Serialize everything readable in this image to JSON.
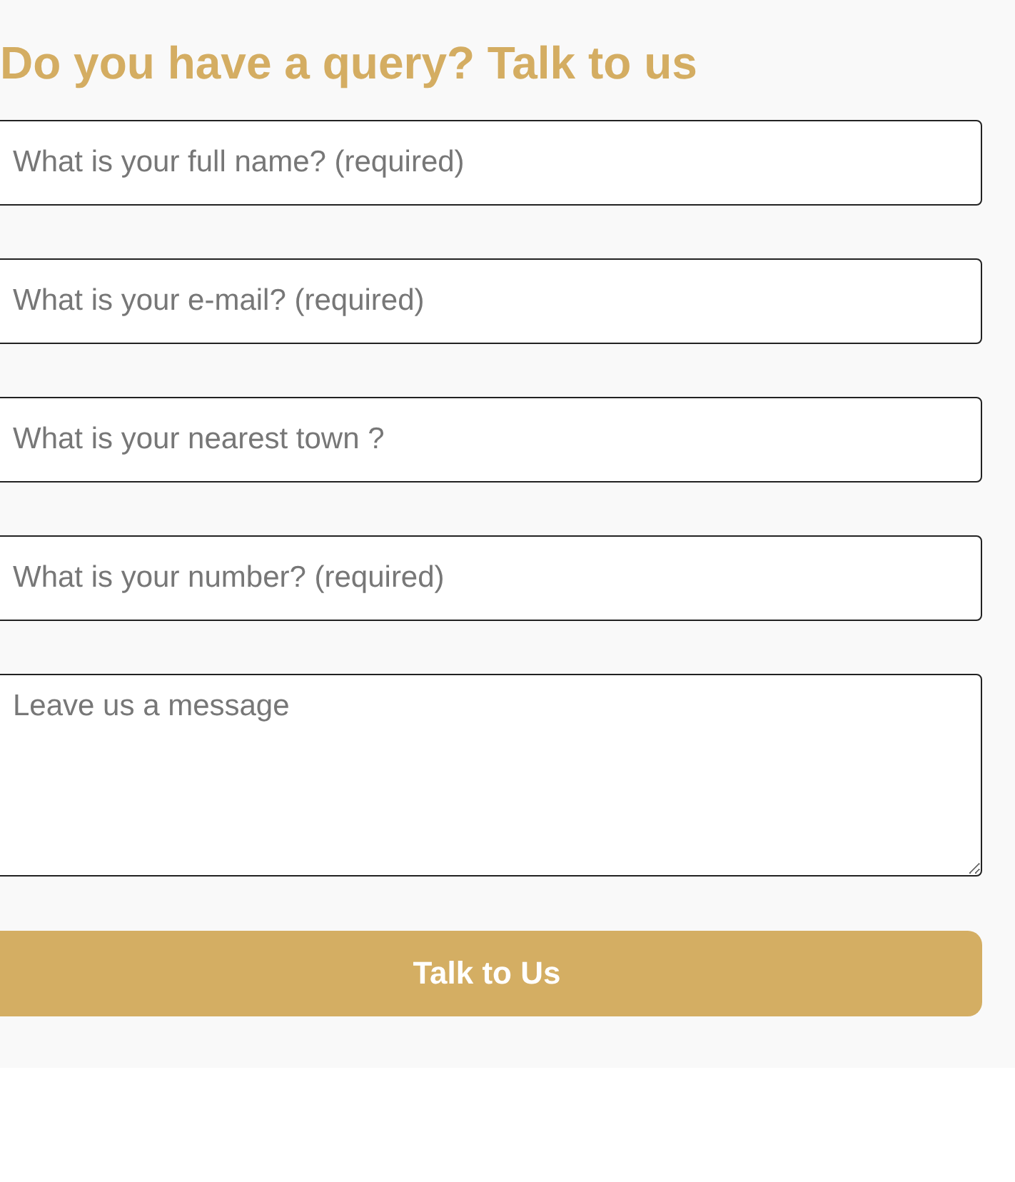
{
  "heading": "Do you have a query? Talk to us",
  "fields": [
    {
      "kind": "input",
      "placeholder": "What is your full name? (required)"
    },
    {
      "kind": "input",
      "placeholder": "What is your e-mail? (required)"
    },
    {
      "kind": "input",
      "placeholder": "What is your nearest town ?"
    },
    {
      "kind": "input",
      "placeholder": "What is your number? (required)"
    },
    {
      "kind": "textarea",
      "placeholder": "Leave us a message"
    }
  ],
  "submit_button": "Talk to Us"
}
